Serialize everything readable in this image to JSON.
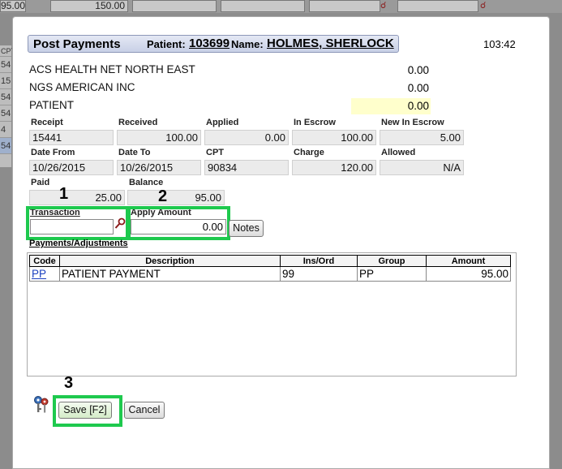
{
  "background": {
    "cells": [
      "95.00",
      "150.00"
    ],
    "left_column": [
      "CPT",
      "54",
      "15",
      "54",
      "54",
      "4",
      "54"
    ]
  },
  "dialog": {
    "title": "Post Payments",
    "patient_label": "Patient:",
    "patient_id": "103699",
    "name_label": "Name:",
    "patient_name": "HOLMES, SHERLOCK",
    "timer": "103:42"
  },
  "payers": [
    {
      "name": "ACS HEALTH NET NORTH EAST",
      "amount": "0.00"
    },
    {
      "name": "NGS AMERICAN INC",
      "amount": "0.00"
    },
    {
      "name": "PATIENT",
      "amount": "0.00"
    }
  ],
  "fields": {
    "receipt_label": "Receipt",
    "receipt": "15441",
    "received_label": "Received",
    "received": "100.00",
    "applied_label": "Applied",
    "applied": "0.00",
    "in_escrow_label": "In Escrow",
    "in_escrow": "100.00",
    "new_in_escrow_label": "New In Escrow",
    "new_in_escrow": "5.00",
    "date_from_label": "Date From",
    "date_from": "10/26/2015",
    "date_to_label": "Date To",
    "date_to": "10/26/2015",
    "cpt_label": "CPT",
    "cpt": "90834",
    "charge_label": "Charge",
    "charge": "120.00",
    "allowed_label": "Allowed",
    "allowed": "N/A",
    "paid_label": "Paid",
    "paid": "25.00",
    "balance_label": "Balance",
    "balance": "95.00"
  },
  "transaction": {
    "label": "Transaction",
    "value": ""
  },
  "apply_amount": {
    "label": "Apply Amount",
    "value": "0.00"
  },
  "notes_button": "Notes",
  "payments_label": "Payments/Adjustments",
  "table": {
    "columns": [
      "Code",
      "Description",
      "Ins/Ord",
      "Group",
      "Amount"
    ],
    "rows": [
      {
        "code": "PP",
        "description": "PATIENT PAYMENT",
        "ins_ord": "99",
        "group": "PP",
        "amount": "95.00"
      }
    ]
  },
  "annotations": {
    "one": "1",
    "two": "2",
    "three": "3"
  },
  "buttons": {
    "save": "Save [F2]",
    "cancel": "Cancel"
  },
  "colors": {
    "highlight_green": "#1ec94e",
    "title_bg": "#c8d0e6",
    "patient_highlight": "#ffffcc"
  }
}
